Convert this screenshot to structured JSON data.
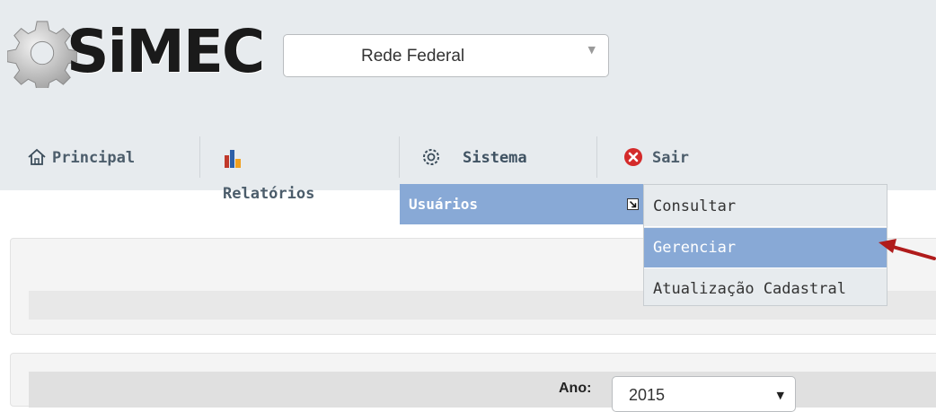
{
  "app": {
    "logo_text": "SiMEC"
  },
  "network_select": {
    "value": "Rede Federal"
  },
  "nav": [
    {
      "label": "Principal",
      "icon": "home-icon"
    },
    {
      "label": "Relatórios",
      "icon": "bar-chart-icon"
    },
    {
      "label": "Sistema",
      "icon": "gear-icon"
    },
    {
      "label": "Sair",
      "icon": "close-circle-icon"
    }
  ],
  "submenu": {
    "label": "Usuários"
  },
  "flyout": [
    {
      "label": "Consultar"
    },
    {
      "label": "Gerenciar"
    },
    {
      "label": "Atualização Cadastral"
    }
  ],
  "filter": {
    "year_label": "Ano:",
    "year_value": "2015"
  },
  "colors": {
    "header_bg": "#e7ebee",
    "menu_highlight": "#88a9d6",
    "nav_text": "#4c5d6b",
    "annotation_arrow": "#b01b1b"
  }
}
